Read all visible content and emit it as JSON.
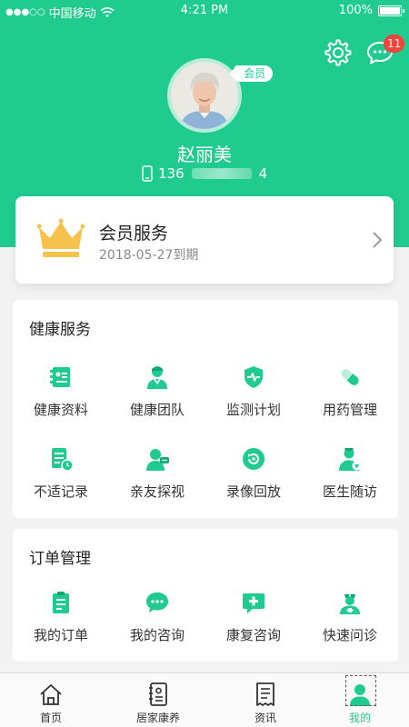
{
  "status_bar": {
    "signal": "●●●○○",
    "carrier": "中国移动",
    "time": "4:21 PM",
    "battery": "100%"
  },
  "header": {
    "message_badge": "11"
  },
  "profile": {
    "member_tag": "会员",
    "name": "赵丽美",
    "phone_prefix": "136",
    "phone_suffix": "4"
  },
  "vip": {
    "title": "会员服务",
    "expire": "2018-05-27到期"
  },
  "health": {
    "title": "健康服务",
    "items": [
      {
        "label": "健康资料",
        "icon": "profile-card-icon"
      },
      {
        "label": "健康团队",
        "icon": "doctor-team-icon"
      },
      {
        "label": "监测计划",
        "icon": "heart-shield-icon"
      },
      {
        "label": "用药管理",
        "icon": "pill-icon"
      },
      {
        "label": "不适记录",
        "icon": "record-clock-icon"
      },
      {
        "label": "亲友探视",
        "icon": "family-chat-icon"
      },
      {
        "label": "录像回放",
        "icon": "replay-icon"
      },
      {
        "label": "医生随访",
        "icon": "doctor-followup-icon"
      }
    ]
  },
  "orders": {
    "title": "订单管理",
    "items": [
      {
        "label": "我的订单",
        "icon": "order-clipboard-icon"
      },
      {
        "label": "我的咨询",
        "icon": "chat-bubble-icon"
      },
      {
        "label": "康复咨询",
        "icon": "rehab-chat-icon"
      },
      {
        "label": "快速问诊",
        "icon": "nurse-icon"
      }
    ]
  },
  "tabbar": {
    "tabs": [
      {
        "label": "首页",
        "icon": "home-icon"
      },
      {
        "label": "居家康养",
        "icon": "home-care-icon"
      },
      {
        "label": "资讯",
        "icon": "news-icon"
      },
      {
        "label": "我的",
        "icon": "person-icon"
      }
    ],
    "active_index": 3
  },
  "colors": {
    "brand": "#1fcb8f",
    "badge": "#f0453a",
    "crown": "#f7c24c"
  }
}
